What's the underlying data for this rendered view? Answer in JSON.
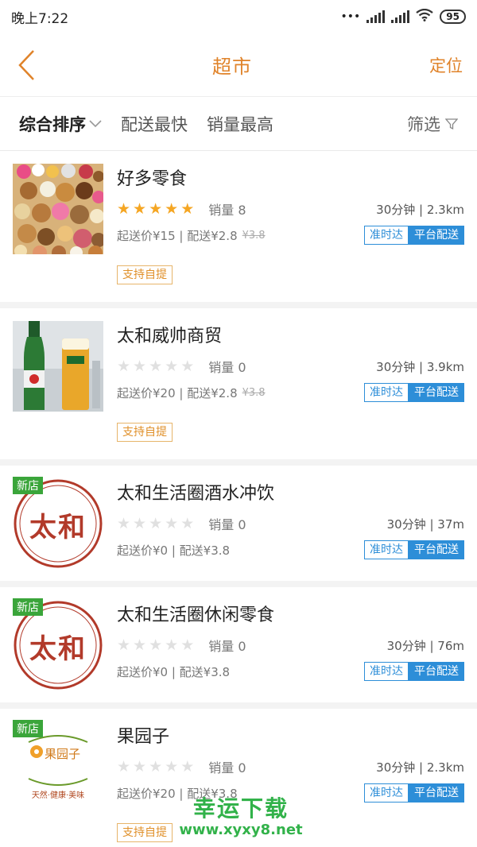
{
  "status": {
    "time": "晚上7:22",
    "network": "HD",
    "battery": "95"
  },
  "nav": {
    "title": "超市",
    "locate": "定位"
  },
  "sort": {
    "items": [
      "综合排序",
      "配送最快",
      "销量最高"
    ],
    "filter": "筛选"
  },
  "shops": [
    {
      "name": "好多零食",
      "rating": 5,
      "sales": "销量 8",
      "time_distance": "30分钟 | 2.3km",
      "price_line": "起送价¥15 | 配送¥2.8",
      "original_fee": "¥3.8",
      "badge1": "准时达",
      "badge2": "平台配送",
      "pickup": "支持自提"
    },
    {
      "name": "太和威帅商贸",
      "rating": 0,
      "sales": "销量 0",
      "time_distance": "30分钟 | 3.9km",
      "price_line": "起送价¥20 | 配送¥2.8",
      "original_fee": "¥3.8",
      "badge1": "准时达",
      "badge2": "平台配送",
      "pickup": "支持自提"
    },
    {
      "name": "太和生活圈酒水冲饮",
      "new_tag": "新店",
      "rating": 0,
      "sales": "销量 0",
      "time_distance": "30分钟 | 37m",
      "price_line": "起送价¥0 | 配送¥3.8",
      "badge1": "准时达",
      "badge2": "平台配送",
      "logo_text": "太和"
    },
    {
      "name": "太和生活圈休闲零食",
      "new_tag": "新店",
      "rating": 0,
      "sales": "销量 0",
      "time_distance": "30分钟 | 76m",
      "price_line": "起送价¥0 | 配送¥3.8",
      "badge1": "准时达",
      "badge2": "平台配送",
      "logo_text": "太和"
    },
    {
      "name": "果园子",
      "new_tag": "新店",
      "rating": 0,
      "sales": "销量 0",
      "time_distance": "30分钟 | 2.3km",
      "price_line": "起送价¥20 | 配送¥3.8",
      "badge1": "准时达",
      "badge2": "平台配送",
      "pickup": "支持自提",
      "logo_text": "果园子",
      "logo_sub": "天然·健康·美味"
    }
  ],
  "watermark": {
    "title": "幸运下载",
    "url": "www.xyxy8.net"
  },
  "colors": {
    "accent": "#e0832a",
    "blue": "#2d8ed8",
    "green": "#3aa53a",
    "star": "#f5a623"
  }
}
